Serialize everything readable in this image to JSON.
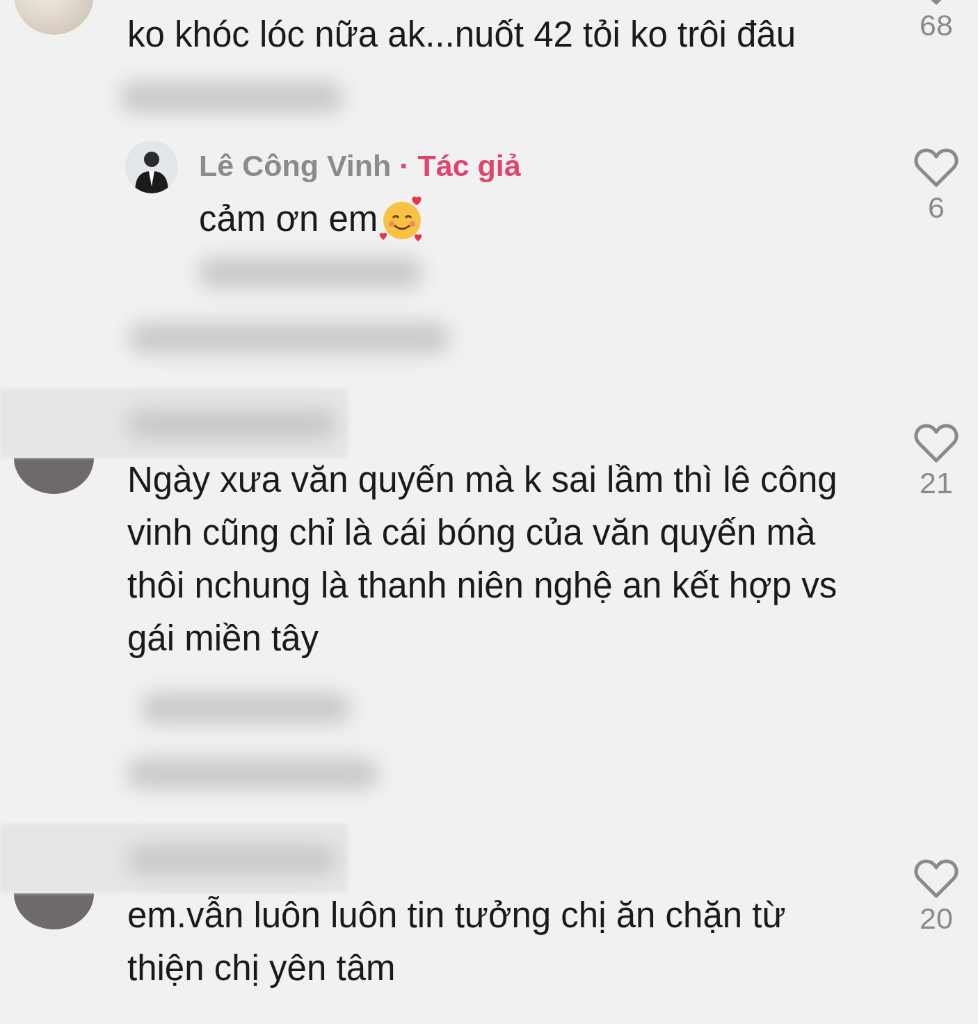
{
  "comments": [
    {
      "kind": "comment",
      "text": "ko khóc lóc nữa ak...nuốt 42 tỏi ko trôi đâu",
      "likes": "68"
    },
    {
      "kind": "reply",
      "author": "Lê Công Vinh",
      "separator": "·",
      "badge": "Tác giả",
      "text": "cảm ơn em",
      "likes": "6"
    },
    {
      "kind": "comment",
      "text": "Ngày xưa văn quyến mà k sai lầm thì lê công vinh cũng chỉ là cái bóng của văn quyến mà thôi nchung là thanh niên nghệ an kết hợp vs gái miền tây",
      "likes": "21"
    },
    {
      "kind": "comment",
      "text": "em.vẫn luôn luôn tin tưởng chị ăn chặn từ thiện chị yên tâm",
      "likes": "20"
    }
  ]
}
